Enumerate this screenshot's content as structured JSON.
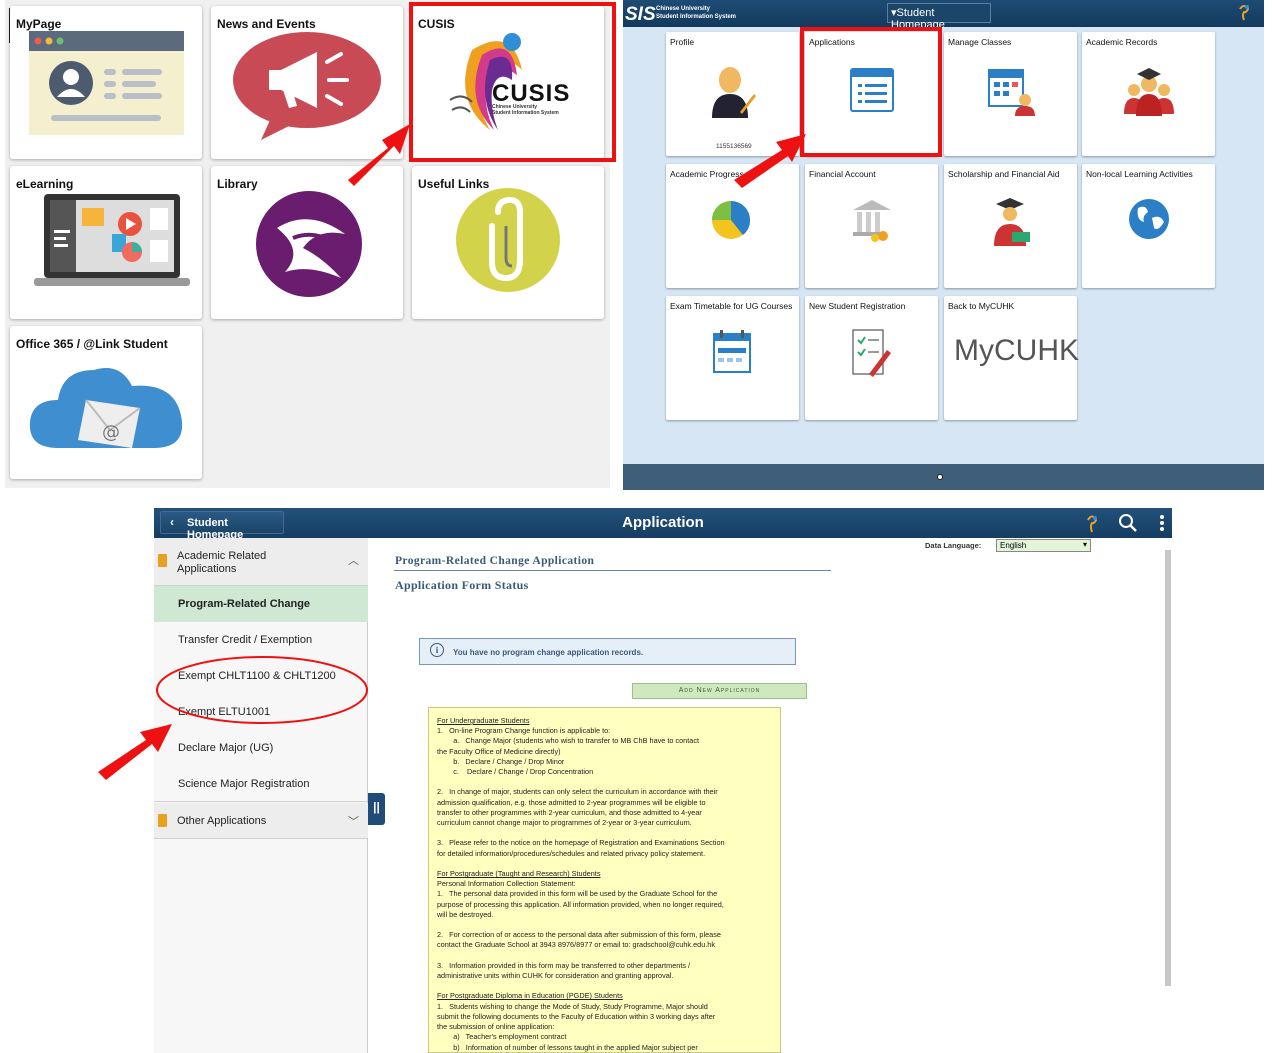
{
  "panel1": {
    "tiles": [
      {
        "label": "MyPage"
      },
      {
        "label": "News and Events"
      },
      {
        "label": "CUSIS"
      },
      {
        "label": "eLearning"
      },
      {
        "label": "Library"
      },
      {
        "label": "Useful Links"
      },
      {
        "label": "Office 365 / @Link Student"
      }
    ],
    "cusis_logo": {
      "title": "CUSIS",
      "sub1": "Chinese University",
      "sub2": "Student Information System"
    }
  },
  "panel2": {
    "logo": {
      "title": "SIS",
      "sub1": "Chinese University",
      "sub2": "Student Information System"
    },
    "homepage_selector": "▾Student Homepage",
    "tiles": [
      {
        "label": "Profile"
      },
      {
        "label": "Applications"
      },
      {
        "label": "Manage Classes"
      },
      {
        "label": "Academic Records"
      },
      {
        "label": "Academic Progress"
      },
      {
        "label": "Financial Account"
      },
      {
        "label": "Scholarship and Financial Aid"
      },
      {
        "label": "Non-local Learning Activities"
      },
      {
        "label": "Exam Timetable for UG Courses"
      },
      {
        "label": "New Student Registration"
      },
      {
        "label": "Back to MyCUHK"
      }
    ],
    "profile_id": "1155136569",
    "mycuhk_text": "MyCUHK"
  },
  "panel3": {
    "back_button": "Student Homepage",
    "title": "Application",
    "data_language_label": "Data Language:",
    "data_language_value": "English",
    "sidebar": {
      "group1": "Academic Related Applications",
      "items": [
        "Program-Related Change",
        "Transfer Credit / Exemption",
        "Exempt CHLT1100 & CHLT1200",
        "Exempt ELTU1001",
        "Declare Major (UG)",
        "Science Major Registration"
      ],
      "group2": "Other Applications"
    },
    "page_heading": "Program-Related Change Application",
    "sub_heading": "Application Form Status",
    "info_message": "You have no program change application records.",
    "add_button": "Add New Application",
    "notes": [
      {
        "u": true,
        "t": "For Undergraduate Students"
      },
      {
        "t": "1.   On-line Program Change function is applicable to:"
      },
      {
        "t": "        a.   Change Major (students who wish to transfer to MB ChB have to contact"
      },
      {
        "t": "the Faculty Office of Medicine directly)"
      },
      {
        "t": "        b.   Declare / Change / Drop Minor"
      },
      {
        "t": "        c.    Declare / Change / Drop Concentration"
      },
      {
        "t": " "
      },
      {
        "t": "2.   In change of major, students can only select the curriculum in accordance with their"
      },
      {
        "t": "admission qualification, e.g. those admitted to 2-year programmes will be eligible to"
      },
      {
        "t": "transfer to other programmes with 2-year curriculum, and those admitted to 4-year"
      },
      {
        "t": "curriculum cannot change major to programmes of 2-year or 3-year curriculum."
      },
      {
        "t": " "
      },
      {
        "t": "3.   Please refer to the notice on the homepage of Registration and Examinations Section"
      },
      {
        "t": "for detailed information/procedures/schedules and related privacy policy statement."
      },
      {
        "t": " "
      },
      {
        "u": true,
        "t": "For Postgraduate (Taught and Research) Students"
      },
      {
        "t": "Personal Information Collection Statement:"
      },
      {
        "t": "1.   The personal data provided in this form will be used by the Graduate School for the"
      },
      {
        "t": "purpose of processing this application. All information provided, when no longer required,"
      },
      {
        "t": "will be destroyed."
      },
      {
        "t": " "
      },
      {
        "t": "2.   For correction of or access to the personal data after submission of this form, please"
      },
      {
        "t": "contact the Graduate School at 3943 8976/8977 or email to: gradschool@cuhk.edu.hk"
      },
      {
        "t": " "
      },
      {
        "t": "3.   Information provided in this form may be transferred to other departments /"
      },
      {
        "t": "administrative units within CUHK for consideration and granting approval."
      },
      {
        "t": " "
      },
      {
        "u": true,
        "t": "For Postgraduate Diploma in Education (PGDE) Students"
      },
      {
        "t": "1.   Students wishing to change the Mode of Study, Study Programme, Major should"
      },
      {
        "t": "submit the following documents to the Faculty of Education within 3 working days after"
      },
      {
        "t": "the submission of online application:"
      },
      {
        "t": "        a)   Teacher's employment contract"
      },
      {
        "t": "        b)   Information of number of lessons taught in the applied Major subject per"
      }
    ]
  },
  "colors": {
    "highlight": "#e11111",
    "header": "#1a4570",
    "selected": "#cfe8d4",
    "notes_bg": "#ffffc0"
  }
}
